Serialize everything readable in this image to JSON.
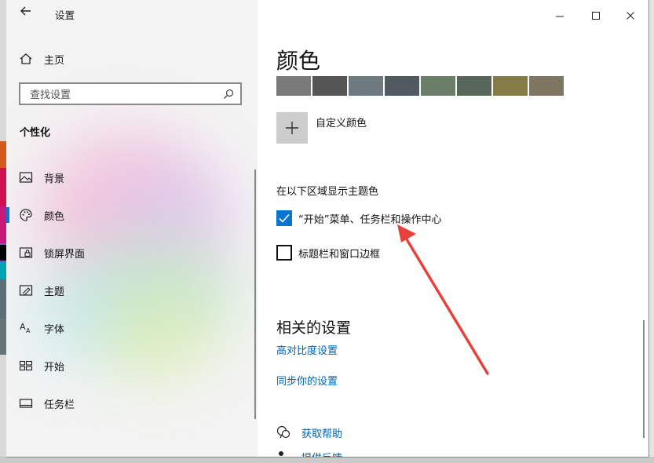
{
  "window": {
    "title": "设置",
    "controls": {
      "minimize": "minimize",
      "maximize": "maximize",
      "close": "close"
    }
  },
  "sidebar": {
    "home_label": "主页",
    "search_placeholder": "查找设置",
    "section_title": "个性化",
    "items": [
      {
        "label": "背景",
        "icon": "picture-icon"
      },
      {
        "label": "颜色",
        "icon": "palette-icon",
        "selected": true
      },
      {
        "label": "锁屏界面",
        "icon": "lock-screen-icon"
      },
      {
        "label": "主题",
        "icon": "theme-icon"
      },
      {
        "label": "字体",
        "icon": "font-icon"
      },
      {
        "label": "开始",
        "icon": "start-icon"
      },
      {
        "label": "任务栏",
        "icon": "taskbar-icon"
      }
    ]
  },
  "main": {
    "title": "颜色",
    "swatches": [
      "#7a7a7a",
      "#555555",
      "#6f7a80",
      "#505a60",
      "#6a7e68",
      "#58655a",
      "#857b47",
      "#7e7660"
    ],
    "custom_color_label": "自定义颜色",
    "accent_heading": "在以下区域显示主题色",
    "checkboxes": [
      {
        "label": "“开始”菜单、任务栏和操作中心",
        "checked": true
      },
      {
        "label": "标题栏和窗口边框",
        "checked": false
      }
    ],
    "related_heading": "相关的设置",
    "related_links": [
      "高对比度设置",
      "同步你的设置"
    ],
    "help_links": [
      "获取帮助",
      "提供反馈"
    ]
  },
  "colors": {
    "accent": "#0078d4",
    "link": "#0063b1",
    "annotation_arrow": "#e8413c"
  },
  "desktop_strip_colors": [
    "#d25a1c",
    "#cf0f4e",
    "#c8197a",
    "#6a5bd6",
    "#000000",
    "#00a3b4",
    "#5b6e78",
    "#66717a"
  ]
}
